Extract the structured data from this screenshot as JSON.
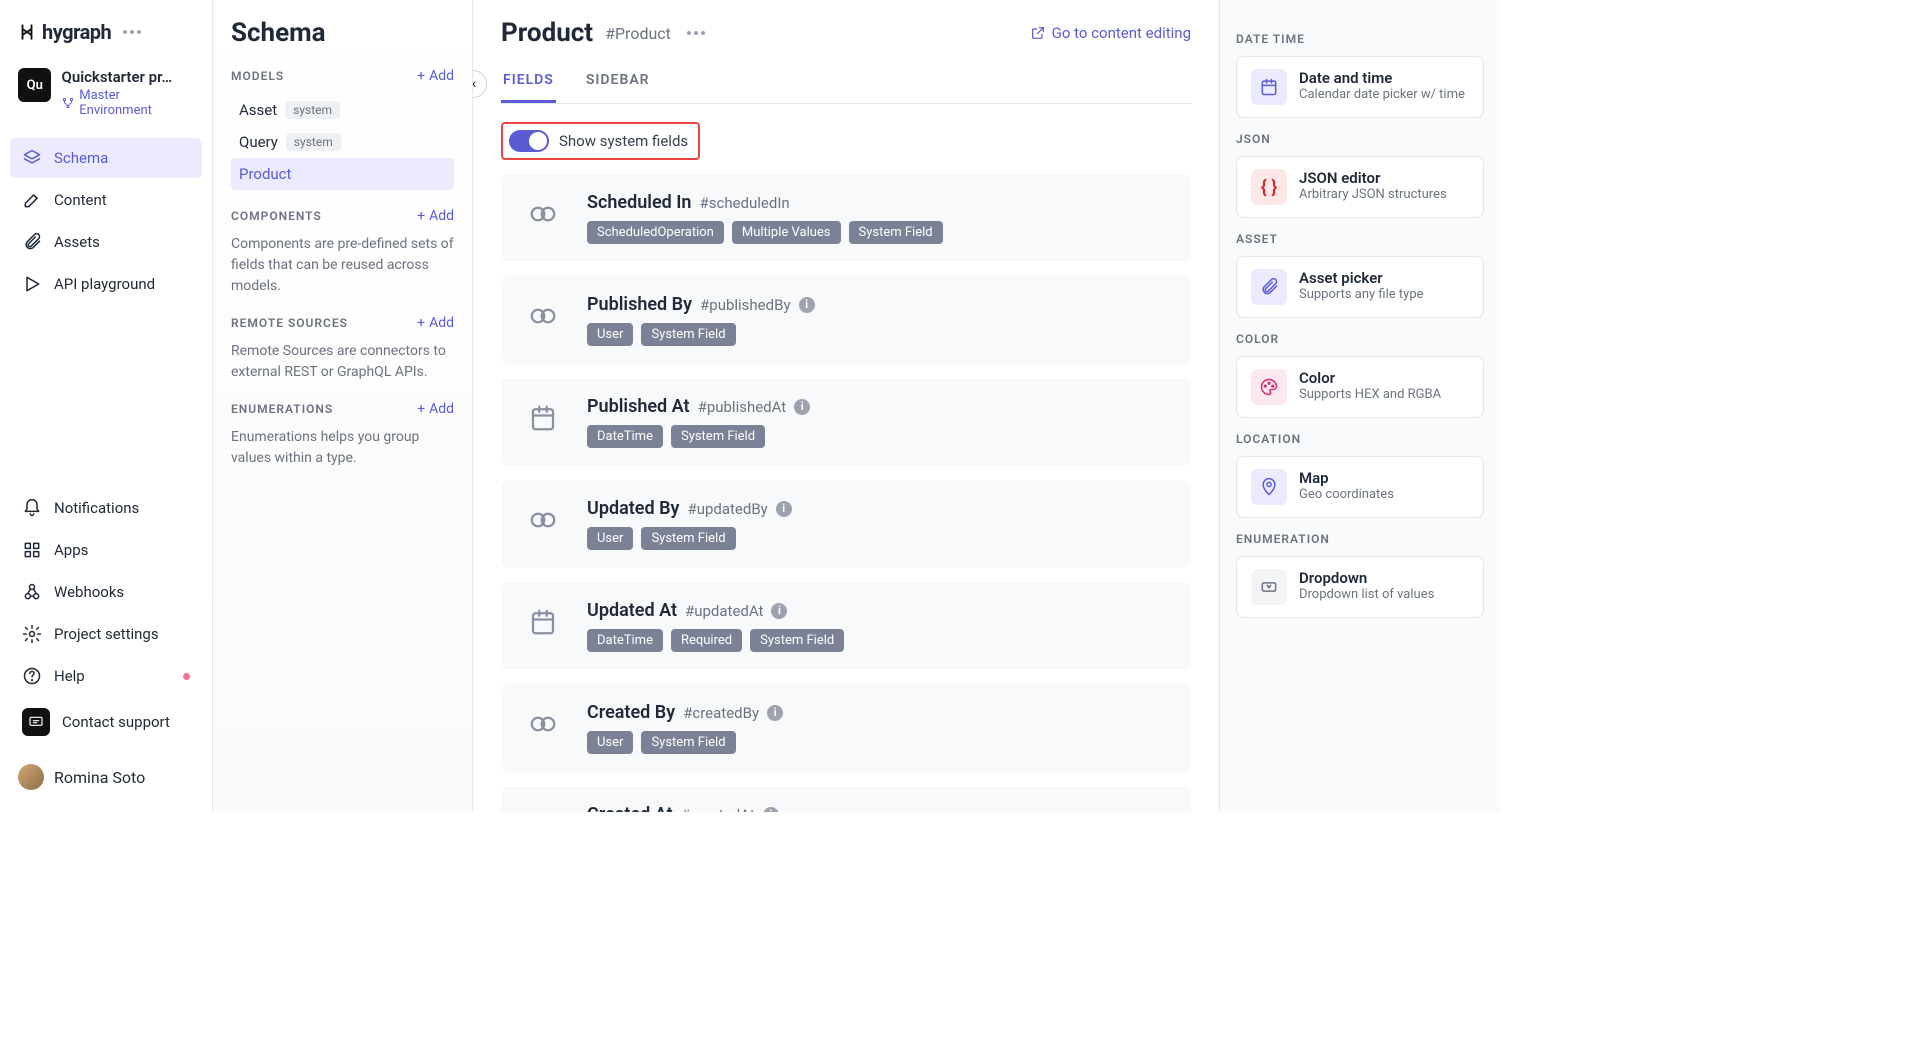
{
  "brand": "hygraph",
  "project": {
    "badge": "Qu",
    "name": "Quickstarter pr…",
    "env": "Master Environment"
  },
  "nav": {
    "primary": [
      {
        "label": "Schema"
      },
      {
        "label": "Content"
      },
      {
        "label": "Assets"
      },
      {
        "label": "API playground"
      }
    ],
    "secondary": [
      {
        "label": "Notifications"
      },
      {
        "label": "Apps"
      },
      {
        "label": "Webhooks"
      },
      {
        "label": "Project settings"
      },
      {
        "label": "Help"
      },
      {
        "label": "Contact support"
      }
    ],
    "user": "Romina Soto"
  },
  "schema": {
    "title": "Schema",
    "sections": {
      "models": {
        "label": "MODELS",
        "add": "Add",
        "items": [
          {
            "name": "Asset",
            "tag": "system"
          },
          {
            "name": "Query",
            "tag": "system"
          },
          {
            "name": "Product"
          }
        ]
      },
      "components": {
        "label": "COMPONENTS",
        "add": "Add",
        "desc": "Components are pre-defined sets of fields that can be reused across models."
      },
      "remote": {
        "label": "REMOTE SOURCES",
        "add": "Add",
        "desc": "Remote Sources are connectors to external REST or GraphQL APIs."
      },
      "enums": {
        "label": "ENUMERATIONS",
        "add": "Add",
        "desc": "Enumerations helps you group values within a type."
      }
    }
  },
  "page": {
    "title": "Product",
    "apiId": "#Product",
    "editLink": "Go to content editing",
    "tabs": {
      "fields": "FIELDS",
      "sidebar": "SIDEBAR"
    },
    "toggle": "Show system fields",
    "fields": [
      {
        "icon": "link",
        "name": "Scheduled In",
        "api": "#scheduledIn",
        "pills": [
          "ScheduledOperation",
          "Multiple Values",
          "System Field"
        ],
        "info": false
      },
      {
        "icon": "link",
        "name": "Published By",
        "api": "#publishedBy",
        "pills": [
          "User",
          "System Field"
        ],
        "info": true
      },
      {
        "icon": "calendar",
        "name": "Published At",
        "api": "#publishedAt",
        "pills": [
          "DateTime",
          "System Field"
        ],
        "info": true
      },
      {
        "icon": "link",
        "name": "Updated By",
        "api": "#updatedBy",
        "pills": [
          "User",
          "System Field"
        ],
        "info": true
      },
      {
        "icon": "calendar",
        "name": "Updated At",
        "api": "#updatedAt",
        "pills": [
          "DateTime",
          "Required",
          "System Field"
        ],
        "info": true
      },
      {
        "icon": "link",
        "name": "Created By",
        "api": "#createdBy",
        "pills": [
          "User",
          "System Field"
        ],
        "info": true
      },
      {
        "icon": "calendar",
        "name": "Created At",
        "api": "#createdAt",
        "pills": [],
        "info": true
      }
    ]
  },
  "rail": [
    {
      "section": "DATE TIME",
      "icon": "calendar",
      "cls": "ri-purple",
      "title": "Date and time",
      "desc": "Calendar date picker w/ time"
    },
    {
      "section": "JSON",
      "icon": "braces",
      "cls": "ri-red",
      "title": "JSON editor",
      "desc": "Arbitrary JSON structures"
    },
    {
      "section": "ASSET",
      "icon": "clip",
      "cls": "ri-purple",
      "title": "Asset picker",
      "desc": "Supports any file type"
    },
    {
      "section": "COLOR",
      "icon": "palette",
      "cls": "ri-pink",
      "title": "Color",
      "desc": "Supports HEX and RGBA"
    },
    {
      "section": "LOCATION",
      "icon": "pin",
      "cls": "ri-purple",
      "title": "Map",
      "desc": "Geo coordinates"
    },
    {
      "section": "ENUMERATION",
      "icon": "dropdown",
      "cls": "ri-gray",
      "title": "Dropdown",
      "desc": "Dropdown list of values"
    }
  ]
}
